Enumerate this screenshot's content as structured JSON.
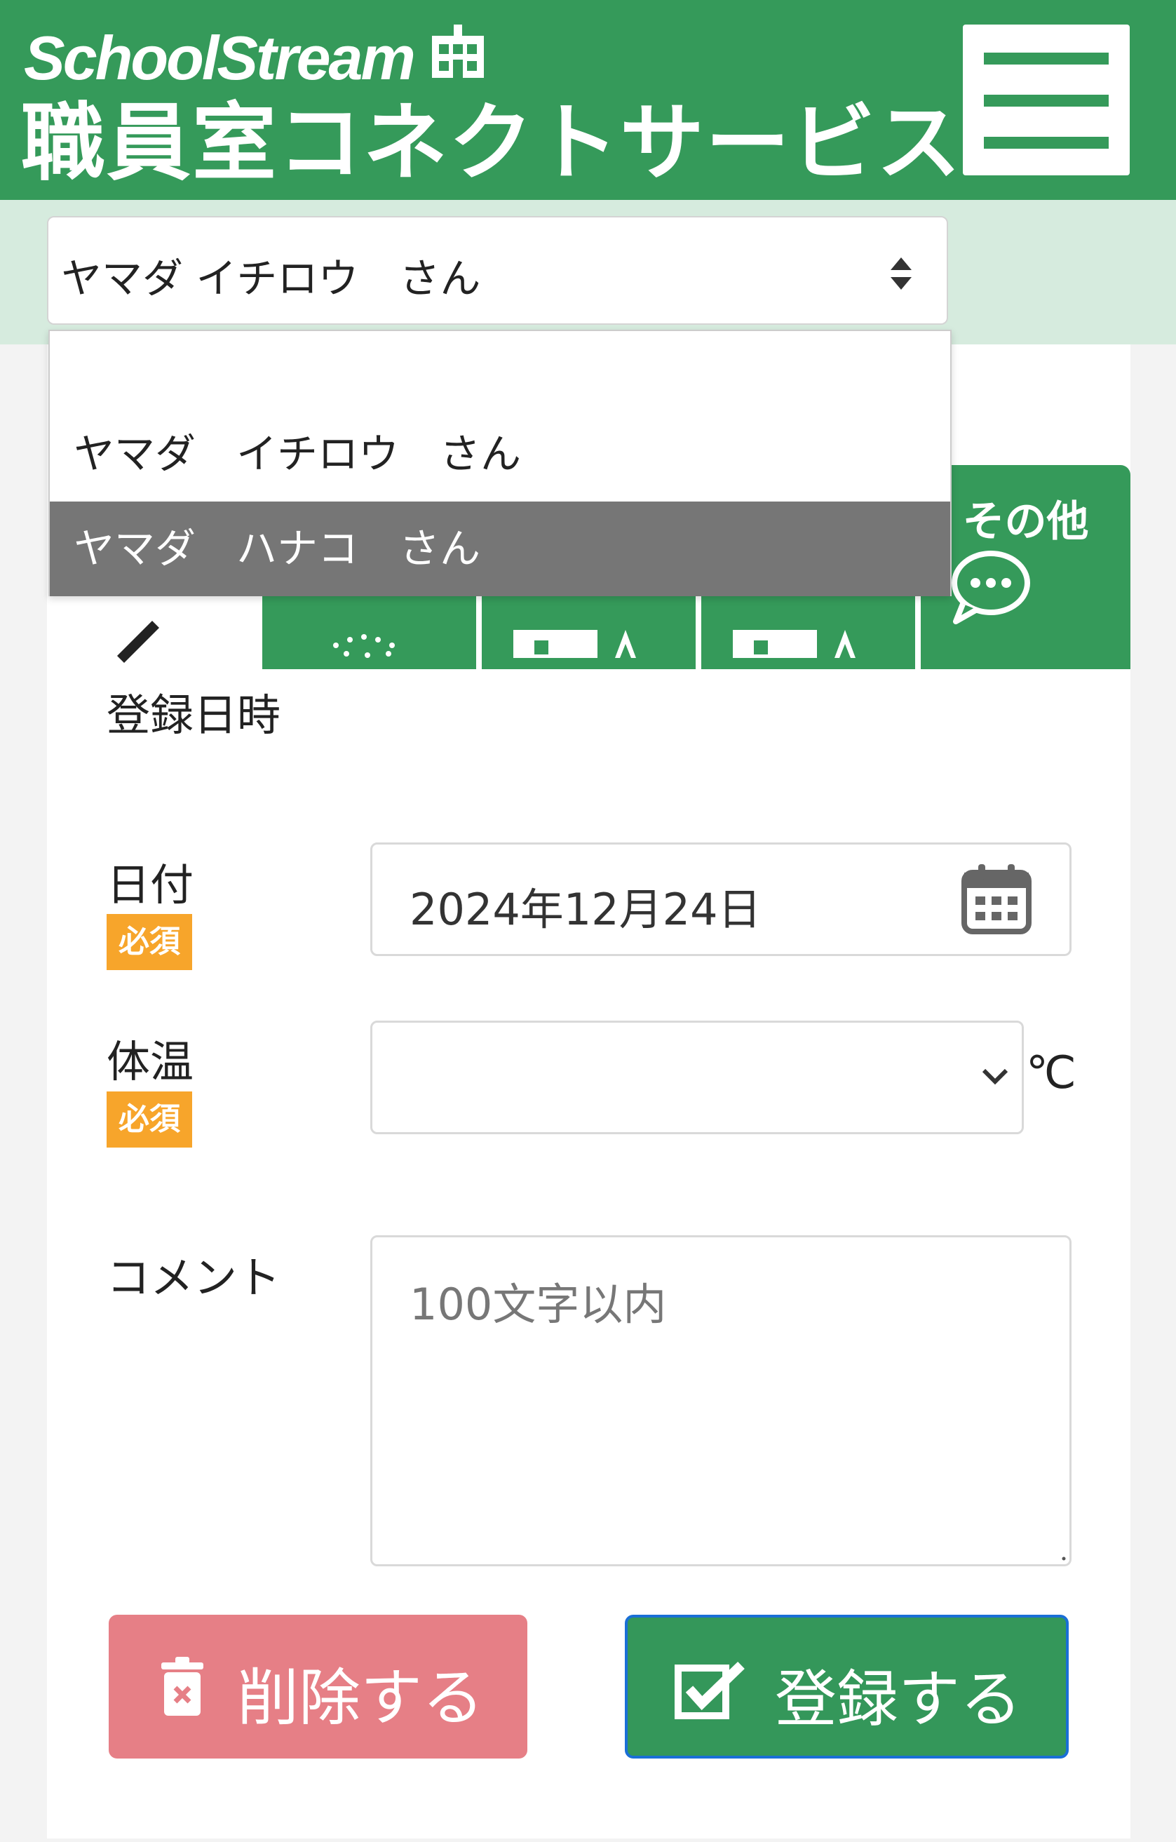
{
  "header": {
    "logo_en": "SchoolStream",
    "logo_jp": "職員室コネクトサービス",
    "menu_icon": "hamburger-menu-icon",
    "color": "#359a5a"
  },
  "child_selector": {
    "selected": "ヤマダ イチロウ　さん",
    "options": [
      "",
      "ヤマダ　イチロウ　さん",
      "ヤマダ　ハナコ　さん"
    ],
    "highlighted_index": 2
  },
  "tabs": {
    "other_label": "その他",
    "other_icon": "chat-bubble-icon"
  },
  "form": {
    "section_title": "登録日時",
    "date_label": "日付",
    "required_badge": "必須",
    "date_value": "2024年12月24日",
    "date_icon": "calendar-icon",
    "temp_label": "体温",
    "temp_value": "",
    "temp_unit": "℃",
    "comment_label": "コメント",
    "comment_placeholder": "100文字以内"
  },
  "actions": {
    "delete_label": "削除する",
    "register_label": "登録する",
    "delete_color": "#e67f86",
    "register_color": "#34975a"
  }
}
